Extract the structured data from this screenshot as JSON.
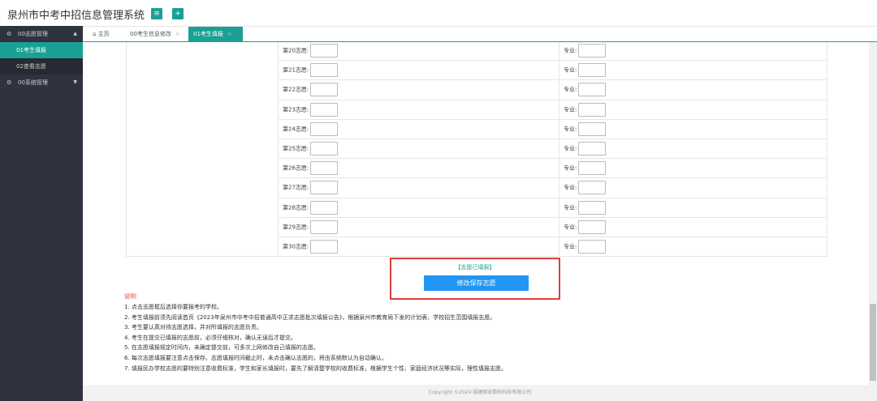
{
  "header": {
    "title": "泉州市中考中招信息管理系统",
    "menu_icon": "≡",
    "add_icon": "+"
  },
  "sidebar": {
    "items": [
      {
        "label": "00志愿管理",
        "icon": "gear-icon",
        "arrow": "▲"
      },
      {
        "label": "01考生填报",
        "active": true
      },
      {
        "label": "02查看志愿"
      },
      {
        "label": "00系统管理",
        "icon": "gear-icon",
        "arrow": "▼"
      }
    ]
  },
  "tabs": [
    {
      "label": "主页",
      "icon": "home-icon"
    },
    {
      "label": "00考生信息修改",
      "close": "×"
    },
    {
      "label": "01考生填报",
      "close": "×",
      "active": true
    }
  ],
  "form": {
    "major_label": "专业:",
    "rows": [
      "第20志愿:",
      "第21志愿:",
      "第22志愿:",
      "第23志愿:",
      "第24志愿:",
      "第25志愿:",
      "第26志愿:",
      "第27志愿:",
      "第28志愿:",
      "第29志愿:",
      "第30志愿:"
    ]
  },
  "status": "【志愿已填报】",
  "save_button": "修改保存志愿",
  "notes": {
    "title": "说明:",
    "items": [
      "1. 点击志愿框后选择你要报考的学校。",
      "2. 考生填报前须先阅读首页《2023年泉州市中考中招普通高中正求志愿批次填报公告》，根据泉州市教育局下发的计划表、学校招生范围填报志愿。",
      "3. 考生要认真对待志愿选择，并对所填报的志愿负责。",
      "4. 考生在提交已填报的志愿前，必须仔细核对，确认无误后才提交。",
      "5. 在志愿填报规定时间内，未确定提交前，可多次上网修改自己填报的志愿。",
      "6. 每次志愿填报要注意点击保存。志愿填报时间截止时，未点击确认志愿的，将由系统默认为自动确认。",
      "7. 填报民办学校志愿的要特别注意收费标准，学生和家长填报时，要先了解清楚学校的收费标准，根据学生个性、家庭经济状况等实际，理性填报志愿。"
    ]
  },
  "footer": "Copyright ©2024 福建网安数码科技有限公司",
  "colors": {
    "accent": "#1aa094",
    "sidebar": "#2f3340",
    "button": "#2196f3",
    "highlight": "#d9413b"
  }
}
